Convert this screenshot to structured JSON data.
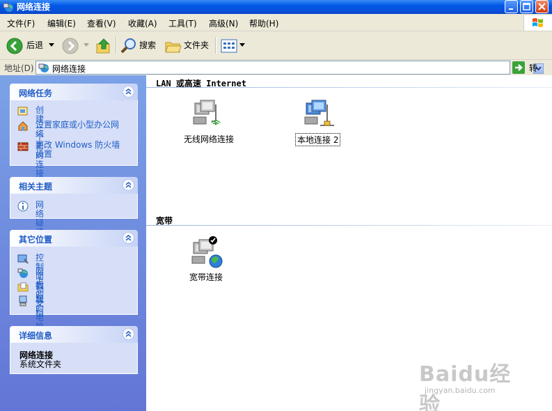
{
  "window": {
    "title": "网络连接"
  },
  "menu": {
    "items": [
      "文件(F)",
      "编辑(E)",
      "查看(V)",
      "收藏(A)",
      "工具(T)",
      "高级(N)",
      "帮助(H)"
    ]
  },
  "toolbar": {
    "back_label": "后退",
    "search_label": "搜索",
    "folders_label": "文件夹"
  },
  "address": {
    "label": "地址(D)",
    "value": "网络连接",
    "go_label": "转到"
  },
  "panels": {
    "network_tasks": {
      "title": "网络任务",
      "items": [
        "创建一个新的连接",
        "设置家庭或小型办公网络",
        "更改 Windows 防火墙设置"
      ]
    },
    "related": {
      "title": "相关主题",
      "items": [
        "网络疑难解答程序"
      ]
    },
    "other_places": {
      "title": "其它位置",
      "items": [
        "控制面板",
        "网上邻居",
        "我的文档",
        "我的电脑"
      ]
    },
    "details": {
      "title": "详细信息",
      "name": "网络连接",
      "type": "系统文件夹"
    }
  },
  "content": {
    "lan_group": "LAN 或高速 Internet",
    "broadband_group": "宽带",
    "connections": [
      "无线网络连接",
      "本地连接 2",
      "宽带连接"
    ]
  },
  "watermark": {
    "brand": "Baidu经验",
    "url": "jingyan.baidu.com"
  },
  "colors": {
    "titlebar": "#0058e6",
    "panel_link": "#215dc6",
    "left_pane": "#6f8fe0"
  }
}
